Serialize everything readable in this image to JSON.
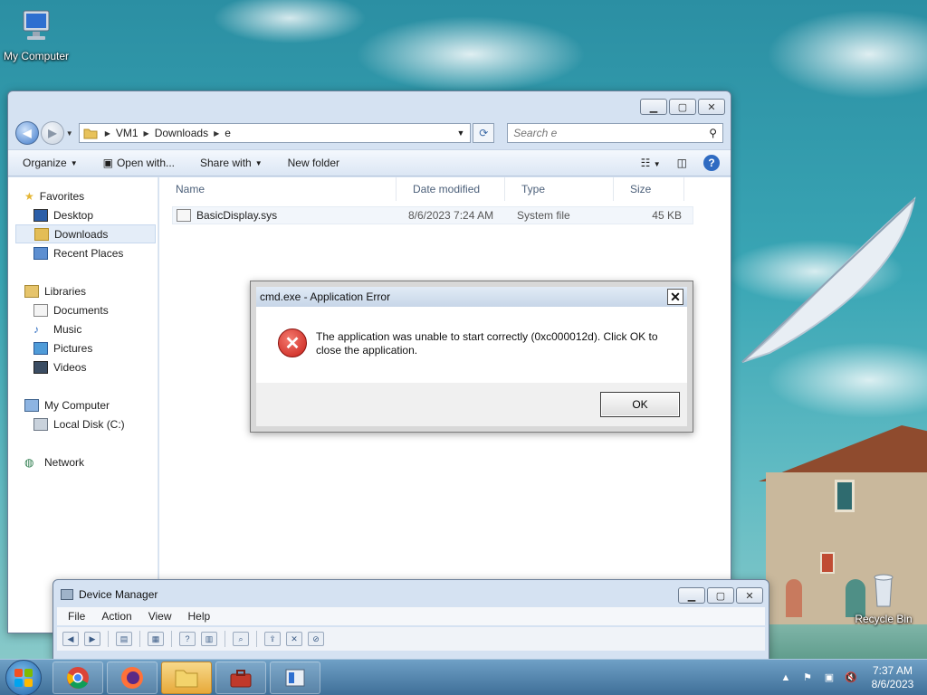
{
  "desktop": {
    "icons": [
      {
        "label": "My Computer"
      },
      {
        "label": "Recycle Bin"
      }
    ]
  },
  "explorer": {
    "breadcrumb": [
      "VM1",
      "Downloads",
      "e"
    ],
    "search_placeholder": "Search e",
    "toolbar": {
      "organize": "Organize",
      "open_with": "Open with...",
      "share_with": "Share with",
      "new_folder": "New folder"
    },
    "nav": {
      "favorites": "Favorites",
      "desktop": "Desktop",
      "downloads": "Downloads",
      "recent_places": "Recent Places",
      "libraries": "Libraries",
      "documents": "Documents",
      "music": "Music",
      "pictures": "Pictures",
      "videos": "Videos",
      "my_computer": "My Computer",
      "local_disk": "Local Disk (C:)",
      "network": "Network"
    },
    "columns": {
      "name": "Name",
      "date": "Date modified",
      "type": "Type",
      "size": "Size"
    },
    "files": [
      {
        "name": "BasicDisplay.sys",
        "date": "8/6/2023 7:24 AM",
        "type": "System file",
        "size": "45 KB"
      }
    ]
  },
  "dialog": {
    "title": "cmd.exe - Application Error",
    "message": "The application was unable to start correctly (0xc000012d). Click OK to close the application.",
    "ok_label": "OK"
  },
  "devmgr": {
    "title": "Device Manager",
    "menu": [
      "File",
      "Action",
      "View",
      "Help"
    ]
  },
  "taskbar": {
    "time": "7:37 AM",
    "date": "8/6/2023"
  }
}
